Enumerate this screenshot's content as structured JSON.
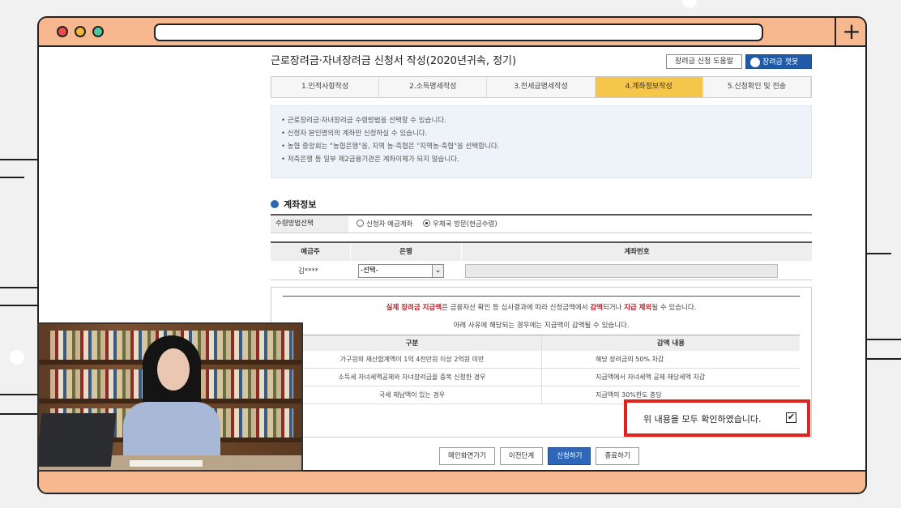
{
  "page": {
    "title": "근로장려금·자녀장려금 신청서 작성(2020년귀속, 정기)",
    "help_button": "장려금 신청 도움말",
    "chatbot_button": "장려금 챗봇"
  },
  "steps": [
    {
      "label": "1.인적사항작성",
      "active": false
    },
    {
      "label": "2.소득명세작성",
      "active": false
    },
    {
      "label": "3.전세금명세작성",
      "active": false
    },
    {
      "label": "4.계좌정보작성",
      "active": true
    },
    {
      "label": "5.신청확인 및 전송",
      "active": false
    }
  ],
  "info": [
    "근로장려금·자녀장려금 수령방법을 선택할 수 있습니다.",
    "신청자 본인명의의 계좌만 신청하실 수 있습니다.",
    "농협 중앙회는 \"농협은행\"을, 지역 농·축협은 \"지역농·축협\"을 선택합니다.",
    "저축은행 등 일부 제2금융기관은 계좌이체가 되지 않습니다."
  ],
  "account_section": {
    "title": "계좌정보",
    "method_label": "수령방법선택",
    "options": [
      "신청자 예금계좌",
      "우체국 방문(현금수령)"
    ],
    "selected_option": 1,
    "columns": [
      "예금주",
      "은행",
      "계좌번호"
    ],
    "holder": "김****",
    "bank_value": "-선택-"
  },
  "notice": {
    "line1_red": "실제 장려금 지급액",
    "line1_mid": "은 금융자산 확인 등 심사결과에 따라 신청금액에서 ",
    "line1_red2": "감액",
    "line1_mid2": "되거나 ",
    "line1_red3": "지급 제외",
    "line1_end": "될 수 있습니다.",
    "line2": "아래 사유에 해당되는 경우에는 지급액이 감액될 수 있습니다.",
    "table_headers": [
      "구분",
      "감액 내용"
    ],
    "rows": [
      {
        "reason": "가구원의 재산합계액이 1억 4천만원 이상 2억원 미만",
        "effect": "해당 장려금의 50% 차감"
      },
      {
        "reason": "소득세 자녀세액공제와 자녀장려금을 중복 신청한 경우",
        "effect": "지급액에서 자녀세액 공제 해당세액 차감"
      },
      {
        "reason": "국세 체납액이 있는 경우",
        "effect": "지급액의 30%한도 충당"
      }
    ]
  },
  "confirm": {
    "label": "위 내용을 모두 확인하였습니다.",
    "checked": true,
    "check_glyph": "✔"
  },
  "actions": [
    "메인화면가기",
    "이전단계",
    "신청하기",
    "종료하기"
  ],
  "browser": {
    "new_tab_symbol": "+",
    "frame_color": "#f7b890",
    "accent": "#2e67b8",
    "highlight_border": "#e0241b"
  }
}
